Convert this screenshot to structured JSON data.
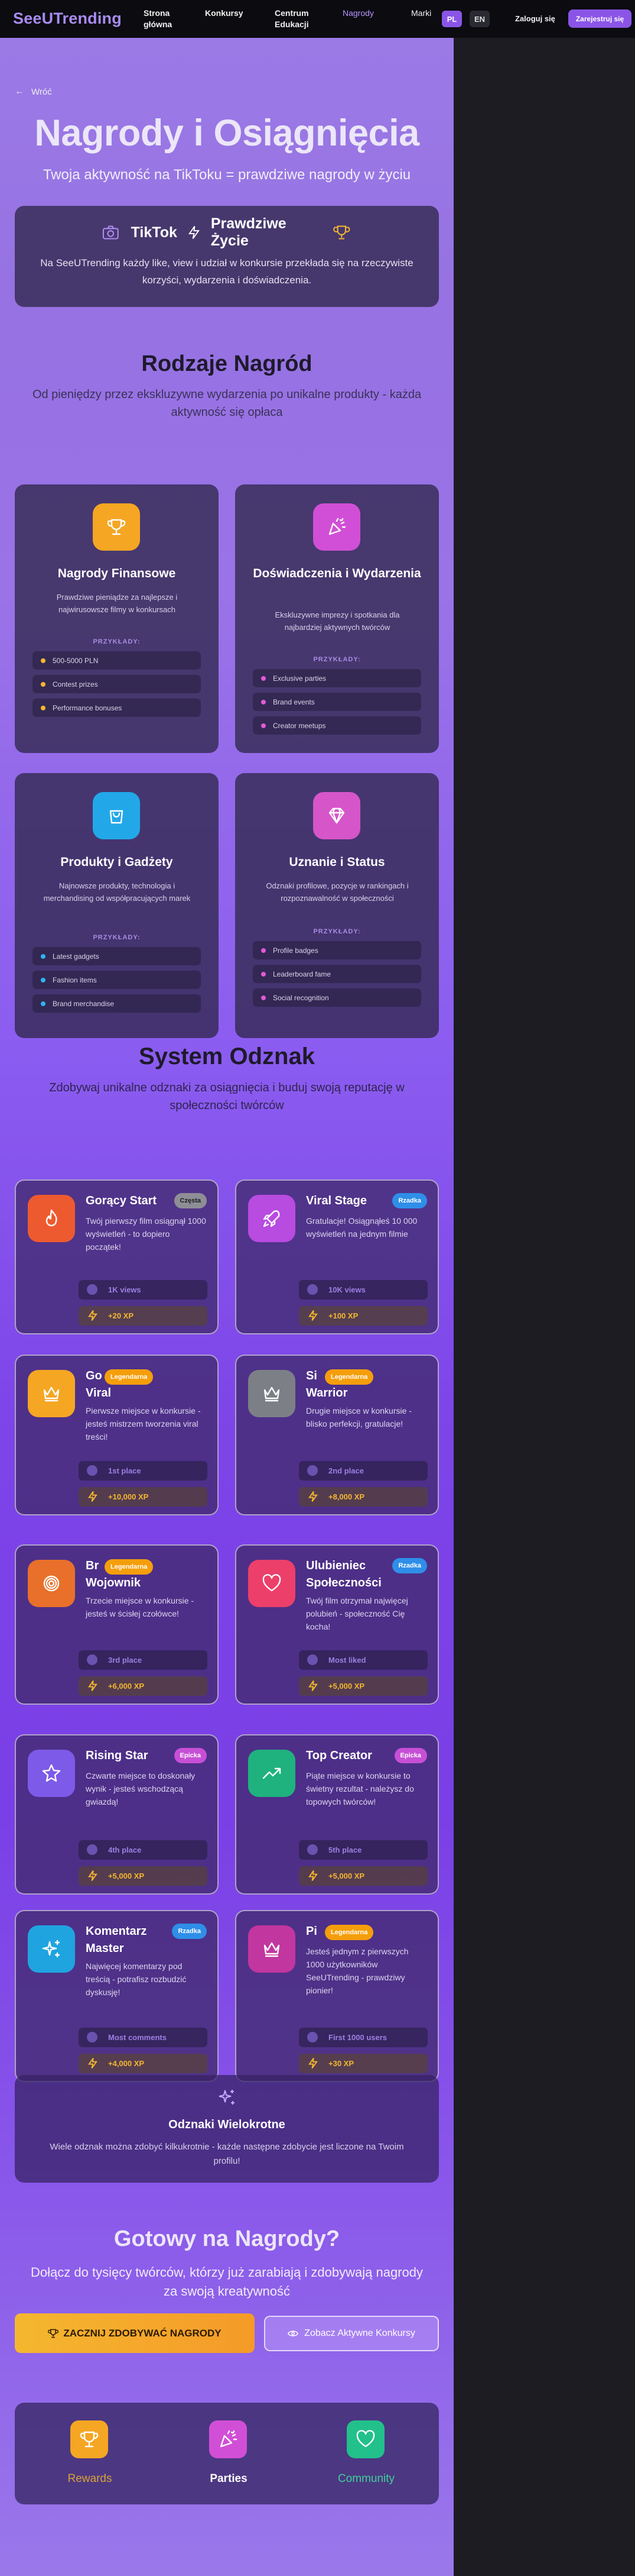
{
  "nav": {
    "logo": "SeeUTrending",
    "items": [
      {
        "label": "Strona\ngłówna"
      },
      {
        "label": "Konkursy"
      },
      {
        "label": "Centrum\nEdukacji"
      },
      {
        "label": "Nagrody"
      },
      {
        "label": "Marki"
      }
    ],
    "lang_pl": "PL",
    "lang_en": "EN",
    "login": "Zaloguj się",
    "register": "Zarejestruj się"
  },
  "hero": {
    "back": "Wróć",
    "title": "Nagrody i Osiągnięcia",
    "subtitle": "Twoja aktywność na TikToku = prawdziwe nagrody w życiu",
    "banner_tiktok": "TikTok",
    "banner_life": "Prawdziwe Życie",
    "banner_text": "Na SeeUTrending każdy like, view i udział w konkursie przekłada się na rzeczywiste korzyści, wydarzenia i doświadczenia."
  },
  "types": {
    "title": "Rodzaje Nagród",
    "subtitle": "Od pieniędzy przez ekskluzywne wydarzenia po unikalne produkty - każda aktywność się opłaca",
    "examples_label": "PRZYKŁADY:",
    "cards": [
      {
        "title": "Nagrody Finansowe",
        "desc": "Prawdziwe pieniądze za najlepsze i najwirusowsze filmy w konkursach",
        "examples": [
          "500-5000 PLN",
          "Contest prizes",
          "Performance bonuses"
        ],
        "color": "#f5a623",
        "dot": "#f5b72f",
        "icon": "trophy-icon"
      },
      {
        "title": "Doświadczenia i Wydarzenia",
        "desc": "Ekskluzywne imprezy i spotkania dla najbardziej aktywnych twórców",
        "examples": [
          "Exclusive parties",
          "Brand events",
          "Creator meetups"
        ],
        "color": "#d14fd6",
        "dot": "#e05ad8",
        "icon": "party-popper-icon"
      },
      {
        "title": "Produkty i Gadżety",
        "desc": "Najnowsze produkty, technologia i merchandising od współpracujących marek",
        "examples": [
          "Latest gadgets",
          "Fashion items",
          "Brand merchandise"
        ],
        "color": "#22a8e8",
        "dot": "#2fb3ee",
        "icon": "shopping-bag-icon"
      },
      {
        "title": "Uznanie i Status",
        "desc": "Odznaki profilowe, pozycje w rankingach i rozpoznawalność w społeczności",
        "examples": [
          "Profile badges",
          "Leaderboard fame",
          "Social recognition"
        ],
        "color": "#d655c9",
        "dot": "#e05ad8",
        "icon": "diamond-icon"
      }
    ]
  },
  "badges": {
    "title": "System Odznak",
    "subtitle": "Zdobywaj unikalne odznaki za osiągnięcia i buduj swoją reputację w społeczności twórców",
    "items": [
      {
        "title": "Gorący Start",
        "rarity": "Częsta",
        "desc": "Twój pierwszy film osiągnął 1000 wyświetleń - to dopiero początek!",
        "req": "1K views",
        "xp": "+20 XP",
        "color": "#ee5a2f",
        "rarity_color": "#8e8e96",
        "icon": "flame-icon"
      },
      {
        "title": "Viral Stage",
        "rarity": "Rzadka",
        "desc": "Gratulacje! Osiągnąłeś 10 000 wyświetleń na jednym filmie",
        "req": "10K views",
        "xp": "+100 XP",
        "color": "#b84be0",
        "rarity_color": "#2f8ee8",
        "icon": "rocket-icon"
      },
      {
        "title": "Go... Viral",
        "title_a": "Go",
        "title_b": "Viral",
        "rarity": "Legendarna",
        "desc": "Pierwsze miejsce w konkursie - jesteś mistrzem tworzenia viral treści!",
        "req": "1st place",
        "xp": "+10,000 XP",
        "color": "#f5a623",
        "rarity_color": "#f59e0b",
        "icon": "crown-icon"
      },
      {
        "title": "Si... Warrior",
        "title_a": "Si",
        "title_b": "Warrior",
        "rarity": "Legendarna",
        "desc": "Drugie miejsce w konkursie - blisko perfekcji, gratulacje!",
        "req": "2nd place",
        "xp": "+8,000 XP",
        "color": "#7c7f86",
        "rarity_color": "#f59e0b",
        "icon": "crown-silver-icon"
      },
      {
        "title": "Br... Wojownik",
        "title_a": "Br",
        "title_b": "Wojownik",
        "rarity": "Legendarna",
        "desc": "Trzecie miejsce w konkursie - jesteś w ścisłej czołówce!",
        "req": "3rd place",
        "xp": "+6,000 XP",
        "color": "#e8702a",
        "rarity_color": "#f59e0b",
        "icon": "target-icon"
      },
      {
        "title": "Ulubieniec Społeczności",
        "title_a": "Ulubieniec",
        "title_b": "Społeczności",
        "rarity": "Rzadka",
        "desc": "Twój film otrzymał najwięcej polubień - społeczność Cię kocha!",
        "req": "Most liked",
        "xp": "+5,000 XP",
        "color": "#ec3f6a",
        "rarity_color": "#2f8ee8",
        "icon": "heart-icon"
      },
      {
        "title": "Rising Star",
        "rarity": "Epicka",
        "desc": "Czwarte miejsce to doskonały wynik - jesteś wschodzącą gwiazdą!",
        "req": "4th place",
        "xp": "+5,000 XP",
        "color": "#7d5ae8",
        "rarity_color": "#c64fd6",
        "icon": "star-icon"
      },
      {
        "title": "Top Creator",
        "rarity": "Epicka",
        "desc": "Piąte miejsce w konkursie to świetny rezultat - należysz do topowych twórców!",
        "req": "5th place",
        "xp": "+5,000 XP",
        "color": "#1fb27e",
        "rarity_color": "#c64fd6",
        "icon": "trending-up-icon"
      },
      {
        "title": "Komentarz Master",
        "title_a": "Komentarz",
        "title_b": "Master",
        "rarity": "Rzadka",
        "desc": "Najwięcej komentarzy pod treścią - potrafisz rozbudzić dyskusję!",
        "req": "Most comments",
        "xp": "+4,000 XP",
        "color": "#1fa4e0",
        "rarity_color": "#2f8ee8",
        "icon": "sparkles-icon"
      },
      {
        "title": "Pi...",
        "title_a": "Pi",
        "title_b": "",
        "rarity": "Legendarna",
        "desc": "Jesteś jednym z pierwszych 1000 użytkowników SeeUTrending - prawdziwy pionier!",
        "req": "First 1000 users",
        "xp": "+30 XP",
        "color": "#c2369f",
        "rarity_color": "#f59e0b",
        "icon": "crown-pink-icon"
      }
    ],
    "multi_title": "Odznaki Wielokrotne",
    "multi_text": "Wiele odznak można zdobyć kilkukrotnie - każde następne zdobycie jest liczone na Twoim profilu!"
  },
  "cta": {
    "title": "Gotowy na Nagrody?",
    "subtitle": "Dołącz do tysięcy twórców, którzy już zarabiają i zdobywają nagrody za swoją kreatywność",
    "primary": "ZACZNIJ ZDOBYWAĆ NAGRODY",
    "secondary": "Zobacz Aktywne Konkursy"
  },
  "bottom": {
    "items": [
      {
        "label": "Rewards",
        "color": "#f5a623",
        "text_color": "#d8a33a"
      },
      {
        "label": "Parties",
        "color": "#d14fd6",
        "text_color": "#ffffff"
      },
      {
        "label": "Community",
        "color": "#22c08a",
        "text_color": "#3fd09a"
      }
    ]
  }
}
